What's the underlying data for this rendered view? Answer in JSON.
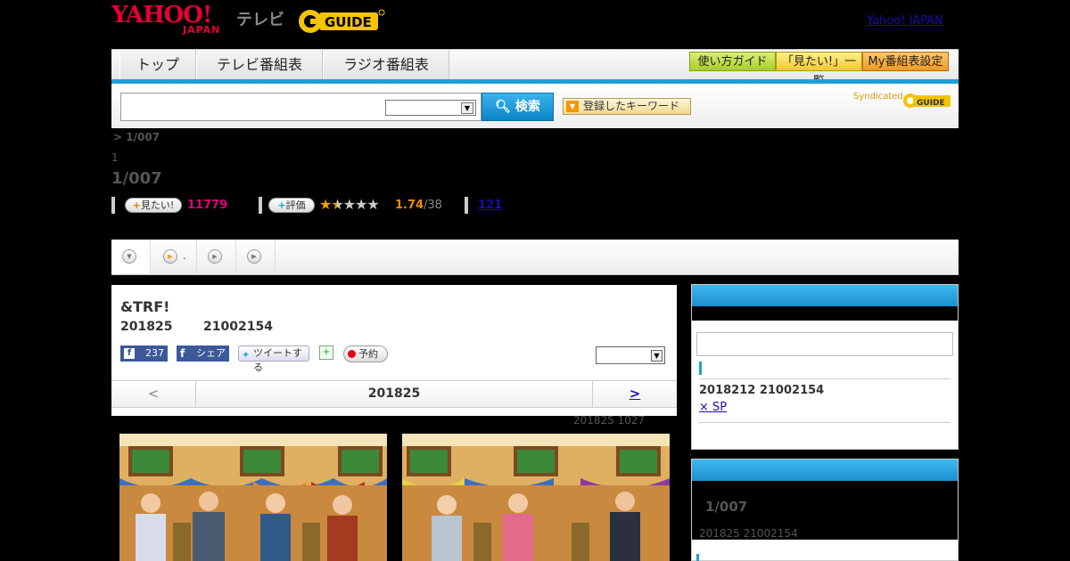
{
  "header": {
    "logo_yahoo": "YAHOO!",
    "logo_japan": "JAPAN",
    "logo_tv": "テレビ",
    "logo_gguide": "G-GUIDE",
    "yahoo_japan_link": "Yahoo! JAPAN"
  },
  "nav": {
    "tabs": [
      {
        "label": "トップ"
      },
      {
        "label": "テレビ番組表"
      },
      {
        "label": "ラジオ番組表"
      }
    ],
    "buttons": [
      {
        "label": "使い方ガイド",
        "color": "#b8d84a"
      },
      {
        "label": "「見たい!」一覧",
        "color": "#f3d54a"
      },
      {
        "label": "My番組表設定",
        "color": "#f3a53a"
      }
    ],
    "accent": "#1e9fd8"
  },
  "search": {
    "placeholder": "",
    "button_label": "検索",
    "keyword_button": "登録したキーワード",
    "syndicated": "Syndicated",
    "syndicated_logo": "G-GUIDE"
  },
  "breadcrumb": "> 1/007",
  "episode_label": "1",
  "title": "1/007",
  "stats": {
    "want_label": "見たい!",
    "want_count": "11779",
    "rate_label": "評価",
    "stars_filled": 1.5,
    "stars_total": 5,
    "rating": "1.74",
    "rating_count": "/38",
    "link_count": "121"
  },
  "tabstrip": {
    "tab2_suffix": "."
  },
  "program": {
    "title": "&TRF!",
    "date": "201825",
    "time": "21002154",
    "fb_like_count": "237",
    "fb_share": "シェア",
    "tweet": "ツイートする",
    "reserve": "予約"
  },
  "date_nav": {
    "prev": "<",
    "current": "201825",
    "next": ">"
  },
  "updated": "201825  1027",
  "sidebar": {
    "box1": {
      "date": "2018212  21002154",
      "link": "× SP"
    },
    "box2": {
      "title": "1/007",
      "date": "201825  21002154"
    }
  }
}
